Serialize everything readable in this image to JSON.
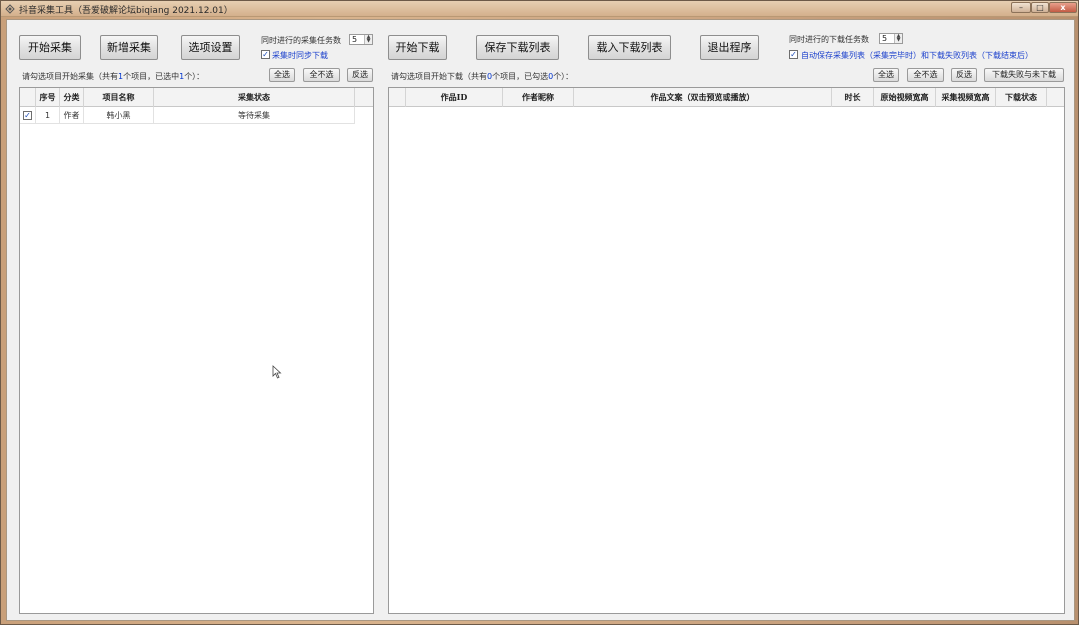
{
  "window": {
    "title": "抖音采集工具（吾爱破解论坛biqiang 2021.12.01）",
    "controls": {
      "minimize": "–",
      "maximize": "□",
      "close": "x"
    }
  },
  "collect": {
    "start_button": "开始采集",
    "add_button": "新增采集",
    "options_button": "选项设置",
    "concurrent_label": "同时进行的采集任务数",
    "concurrent_value": "5",
    "sync_download_label": "采集时同步下载",
    "sync_download_checked": true,
    "hint_prefix": "请勾选项目开始采集（共有",
    "hint_total": "1",
    "hint_mid": "个项目，已选中",
    "hint_selected": "1",
    "hint_suffix": "个）：",
    "select_all": "全选",
    "select_none": "全不选",
    "invert": "反选",
    "columns": [
      "序号",
      "分类",
      "项目名称",
      "采集状态"
    ],
    "rows": [
      {
        "checked": true,
        "index": "1",
        "category": "作者",
        "name": "韩小黑",
        "status": "等待采集"
      }
    ]
  },
  "download": {
    "start_button": "开始下载",
    "save_button": "保存下载列表",
    "load_button": "载入下载列表",
    "exit_button": "退出程序",
    "concurrent_label": "同时进行的下载任务数",
    "concurrent_value": "5",
    "auto_save_label": "自动保存采集列表（采集完毕时）和下载失败列表（下载结束后）",
    "auto_save_checked": true,
    "hint_prefix": "请勾选项目开始下载（共有",
    "hint_total": "0",
    "hint_mid": "个项目，已勾选",
    "hint_selected": "0",
    "hint_suffix": "个）：",
    "select_all": "全选",
    "select_none": "全不选",
    "invert": "反选",
    "download_failed": "下载失败与未下载",
    "columns": [
      "作品ID",
      "作者昵称",
      "作品文案（双击预览或播放）",
      "时长",
      "原始视频宽高",
      "采集视频宽高",
      "下载状态"
    ],
    "rows": []
  }
}
